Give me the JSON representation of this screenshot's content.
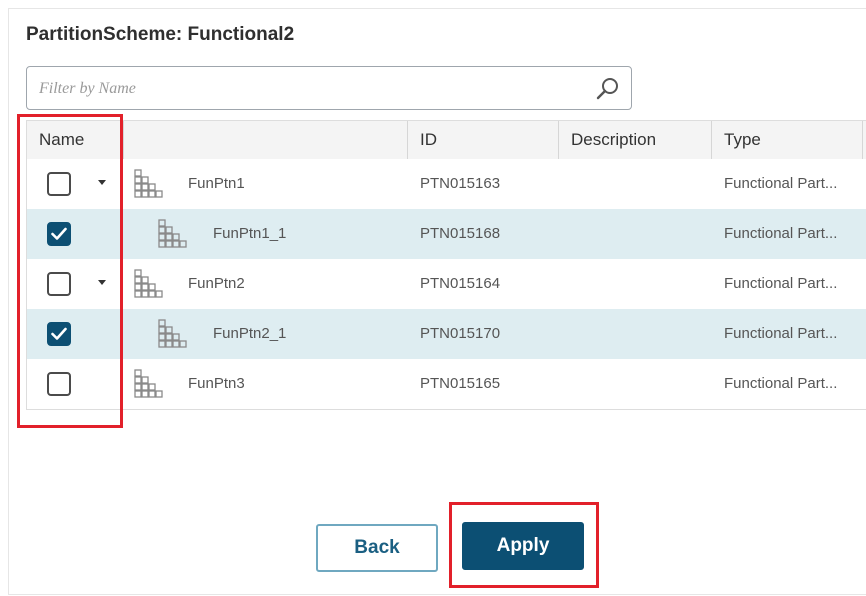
{
  "title": "PartitionScheme: Functional2",
  "filter": {
    "placeholder": "Filter by Name",
    "value": ""
  },
  "columns": {
    "name": "Name",
    "id": "ID",
    "description": "Description",
    "type": "Type"
  },
  "rows": [
    {
      "name": "FunPtn1",
      "id": "PTN015163",
      "description": "",
      "type": "Functional Part...",
      "checked": false,
      "expandable": true,
      "indent": 0,
      "selected": false
    },
    {
      "name": "FunPtn1_1",
      "id": "PTN015168",
      "description": "",
      "type": "Functional Part...",
      "checked": true,
      "expandable": false,
      "indent": 1,
      "selected": true
    },
    {
      "name": "FunPtn2",
      "id": "PTN015164",
      "description": "",
      "type": "Functional Part...",
      "checked": false,
      "expandable": true,
      "indent": 0,
      "selected": false
    },
    {
      "name": "FunPtn2_1",
      "id": "PTN015170",
      "description": "",
      "type": "Functional Part...",
      "checked": true,
      "expandable": false,
      "indent": 1,
      "selected": true
    },
    {
      "name": "FunPtn3",
      "id": "PTN015165",
      "description": "",
      "type": "Functional Part...",
      "checked": false,
      "expandable": false,
      "indent": 0,
      "selected": false
    }
  ],
  "buttons": {
    "back": "Back",
    "apply": "Apply"
  },
  "icons": {
    "search": "search-icon",
    "partition": "partition-icon",
    "expand": "chevron-down-icon",
    "check": "check-icon"
  },
  "colors": {
    "accent": "#0c4f73",
    "selected_row": "#deedf1",
    "highlight": "#e2202a",
    "header": "#f4f4f4"
  }
}
